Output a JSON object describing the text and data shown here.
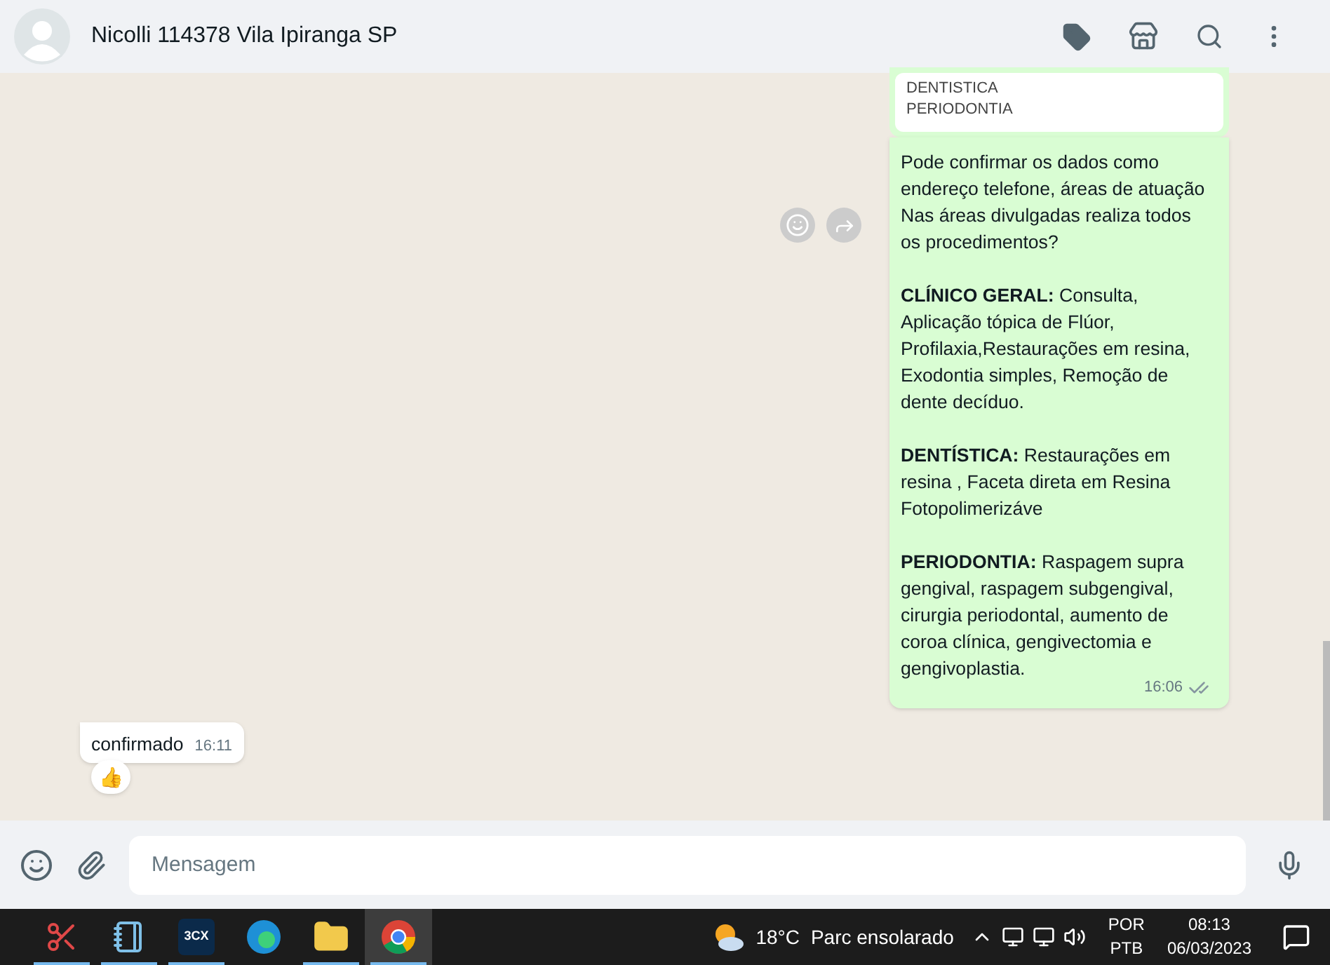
{
  "header": {
    "title": "Nicolli 114378 Vila Ipiranga SP"
  },
  "messages": [
    {
      "kind": "card",
      "lines": [
        "DENTISTICA",
        "PERIODONTIA"
      ]
    },
    {
      "kind": "outgoing",
      "paragraphs": [
        "Pode confirmar os dados como endereço telefone, áreas de atuação Nas áreas divulgadas realiza todos os procedimentos?",
        "**CLÍNICO GERAL:** Consulta, Aplicação tópica de Flúor, Profilaxia,Restaurações em resina, Exodontia simples, Remoção de dente decíduo.",
        "**DENTÍSTICA:** Restaurações em resina , Faceta direta em Resina Fotopolimerizáve",
        "**PERIODONTIA:** Raspagem supra gengival, raspagem subgengival, cirurgia periodontal, aumento de coroa clínica, gengivectomia e gengivoplastia."
      ],
      "time": "16:06",
      "read": false
    },
    {
      "kind": "incoming",
      "text": "confirmado",
      "time": "16:11",
      "reaction": "👍"
    }
  ],
  "composer": {
    "placeholder": "Mensagem"
  },
  "taskbar": {
    "apps": [
      {
        "kind": "snip",
        "running": true,
        "selected": false
      },
      {
        "kind": "notepad",
        "running": true,
        "selected": false
      },
      {
        "kind": "phone",
        "label": "3CX",
        "running": true,
        "selected": false
      },
      {
        "kind": "edge",
        "running": false,
        "selected": false
      },
      {
        "kind": "explorer",
        "running": true,
        "selected": false
      },
      {
        "kind": "chrome",
        "running": true,
        "selected": true
      }
    ],
    "weather": {
      "temp": "18°C",
      "text": "Parc ensolarado"
    },
    "tray": {
      "lang": "POR",
      "layout": "PTB",
      "time": "08:13",
      "date": "06/03/2023"
    }
  }
}
